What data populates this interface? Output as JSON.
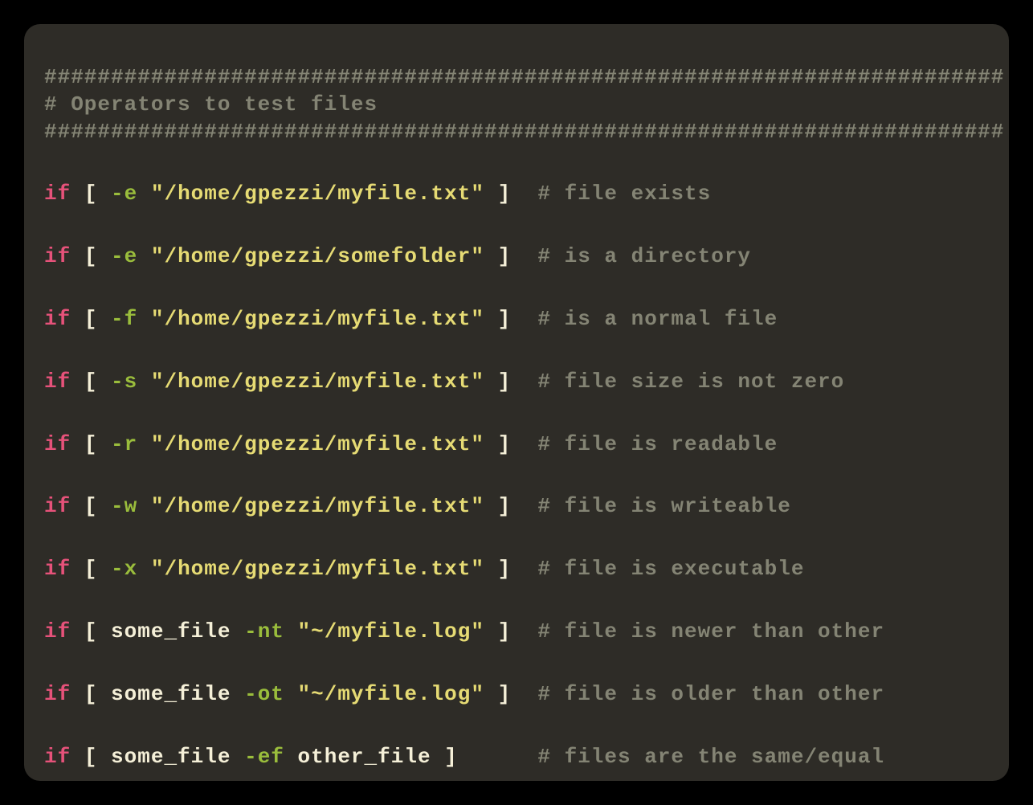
{
  "header": {
    "rule": "########################################################################",
    "title": "# Operators to test files"
  },
  "lines": [
    {
      "kw": "if",
      "lb": "[",
      "flag": "-e",
      "path": "\"/home/gpezzi/myfile.txt\"",
      "rb": "]",
      "comment": "# file exists",
      "pad": 2
    },
    {
      "kw": "if",
      "lb": "[",
      "flag": "-e",
      "path": "\"/home/gpezzi/somefolder\"",
      "rb": "]",
      "comment": "# is a directory",
      "pad": 2
    },
    {
      "kw": "if",
      "lb": "[",
      "flag": "-f",
      "path": "\"/home/gpezzi/myfile.txt\"",
      "rb": "]",
      "comment": "# is a normal file",
      "pad": 2
    },
    {
      "kw": "if",
      "lb": "[",
      "flag": "-s",
      "path": "\"/home/gpezzi/myfile.txt\"",
      "rb": "]",
      "comment": "# file size is not zero",
      "pad": 2
    },
    {
      "kw": "if",
      "lb": "[",
      "flag": "-r",
      "path": "\"/home/gpezzi/myfile.txt\"",
      "rb": "]",
      "comment": "# file is readable",
      "pad": 2
    },
    {
      "kw": "if",
      "lb": "[",
      "flag": "-w",
      "path": "\"/home/gpezzi/myfile.txt\"",
      "rb": "]",
      "comment": "# file is writeable",
      "pad": 2
    },
    {
      "kw": "if",
      "lb": "[",
      "flag": "-x",
      "path": "\"/home/gpezzi/myfile.txt\"",
      "rb": "]",
      "comment": "# file is executable",
      "pad": 2
    },
    {
      "kw": "if",
      "lb": "[",
      "ident": "some_file",
      "flag": "-nt",
      "path": "\"~/myfile.log\"",
      "rb": "]",
      "comment": "# file is newer than other",
      "pad": 2
    },
    {
      "kw": "if",
      "lb": "[",
      "ident": "some_file",
      "flag": "-ot",
      "path": "\"~/myfile.log\"",
      "rb": "]",
      "comment": "# file is older than other",
      "pad": 2
    },
    {
      "kw": "if",
      "lb": "[",
      "ident": "some_file",
      "flag": "-ef",
      "ident2": "other_file",
      "rb": "]",
      "comment": "# files are the same/equal",
      "pad": 6
    }
  ]
}
